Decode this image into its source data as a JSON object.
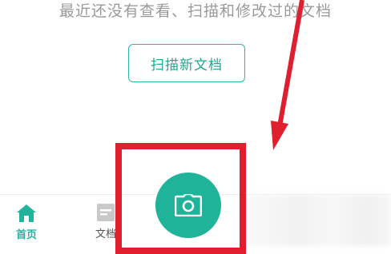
{
  "empty_state": {
    "message": "最近还没有查看、扫描和修改过的文档",
    "scan_button_label": "扫描新文档"
  },
  "tabbar": {
    "items": [
      {
        "label": "首页",
        "icon": "home-icon",
        "active": true
      },
      {
        "label": "文档",
        "icon": "document-icon",
        "active": false
      }
    ]
  },
  "fab": {
    "icon": "camera-icon"
  },
  "colors": {
    "accent": "#1fb39a",
    "highlight": "#e01f2e"
  }
}
